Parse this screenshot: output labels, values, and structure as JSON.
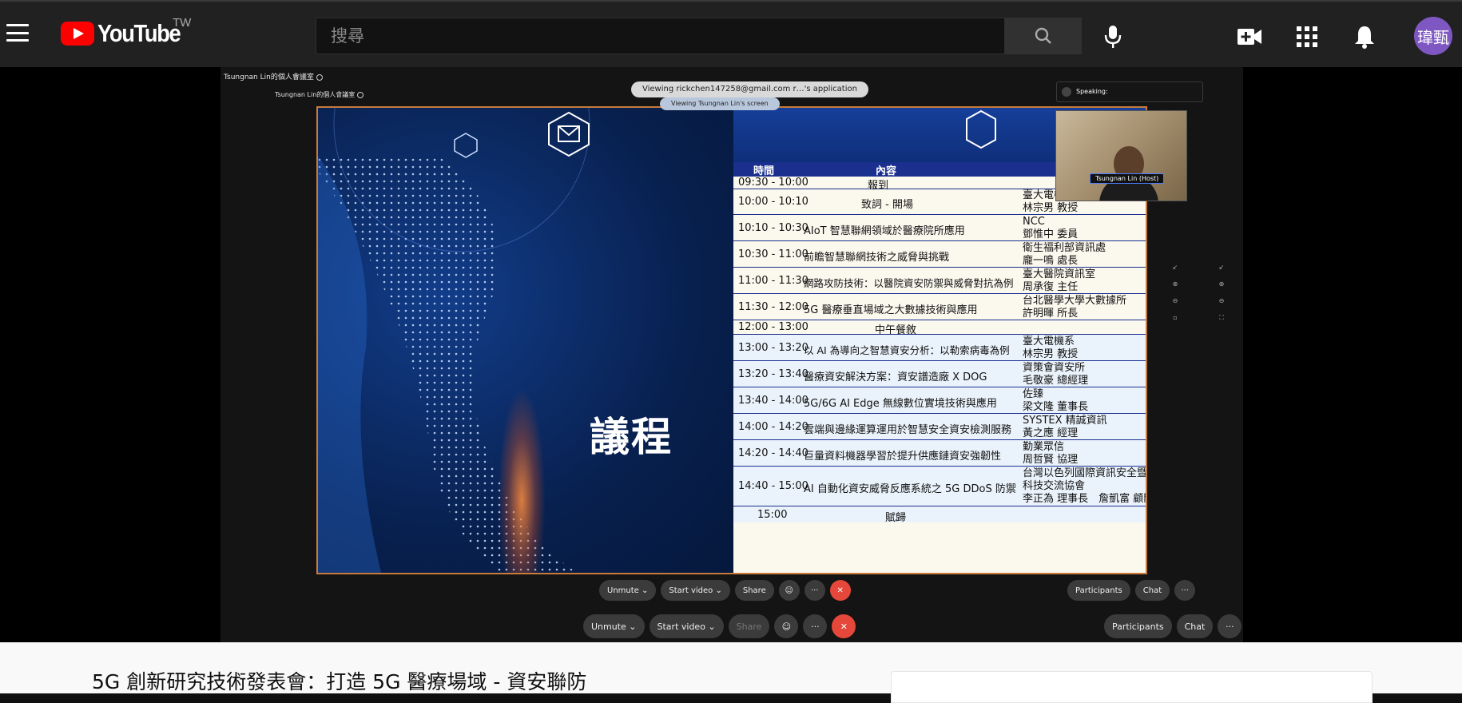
{
  "header": {
    "logo_text": "YouTube",
    "region": "TW",
    "search_placeholder": "搜尋",
    "avatar_text": "瑋甄",
    "icons": [
      "menu-icon",
      "search-icon",
      "mic-icon",
      "create-video-icon",
      "apps-grid-icon",
      "notifications-icon"
    ]
  },
  "meeting": {
    "room_title_outer": "Tsungnan Lin的個人會議室",
    "room_title_inner": "Tsungnan Lin的個人會議室",
    "viewing_app": "Viewing rickchen147258@gmail.com r…'s application",
    "viewing_screen": "Viewing Tsungnan Lin's screen",
    "speaking": "Speaking:",
    "host_tag": "Tsungnan Lin (Host)",
    "controls_inner": {
      "unmute": "Unmute",
      "start_video": "Start video",
      "share": "Share",
      "participants": "Participants",
      "chat": "Chat",
      "more": "···"
    },
    "controls_outer": {
      "unmute": "Unmute",
      "start_video": "Start video",
      "share": "Share",
      "participants": "Participants",
      "chat": "Chat",
      "more": "···"
    }
  },
  "slide": {
    "title": "議程",
    "head_time": "時間",
    "head_content": "內容",
    "rows": [
      {
        "time": "09:30 - 10:00",
        "content": "報到",
        "speaker1": "",
        "speaker2": ""
      },
      {
        "time": "10:00 - 10:10",
        "content": "致詞 - 開場",
        "speaker1": "臺大電機系",
        "speaker2": "林宗男 教授"
      },
      {
        "time": "10:10 - 10:30",
        "content": "AIoT 智慧聯網領域於醫療院所應用",
        "speaker1": "NCC",
        "speaker2": "鄧惟中 委員"
      },
      {
        "time": "10:30 - 11:00",
        "content": "前瞻智慧聯網技術之威脅與挑戰",
        "speaker1": "衛生福利部資訊處",
        "speaker2": "龐一鳴 處長"
      },
      {
        "time": "11:00 - 11:30",
        "content": "網路攻防技術：以醫院資安防禦與威脅對抗為例",
        "speaker1": "臺大醫院資訊室",
        "speaker2": "周承復 主任"
      },
      {
        "time": "11:30 - 12:00",
        "content": "5G 醫療垂直場域之大數據技術與應用",
        "speaker1": "台北醫學大學大數據所",
        "speaker2": "許明暉 所長"
      },
      {
        "time": "12:00 - 13:00",
        "content": "中午餐敘",
        "speaker1": "",
        "speaker2": ""
      },
      {
        "time": "13:00 - 13:20",
        "content": "以 AI 為導向之智慧資安分析：以勒索病毒為例",
        "speaker1": "臺大電機系",
        "speaker2": "林宗男 教授"
      },
      {
        "time": "13:20 - 13:40",
        "content": "醫療資安解決方案：資安譜造廠 X DOG",
        "speaker1": "資策會資安所",
        "speaker2": "毛敬豪 總經理"
      },
      {
        "time": "13:40 - 14:00",
        "content": "5G/6G AI Edge 無線數位實境技術與應用",
        "speaker1": "佐臻",
        "speaker2": "梁文隆 董事長"
      },
      {
        "time": "14:00 - 14:20",
        "content": "雲端與邊緣運算運用於智慧安全資安檢測服務",
        "speaker1": "SYSTEX 精誠資訊",
        "speaker2": "黃之應 經理"
      },
      {
        "time": "14:20 - 14:40",
        "content": "巨量資料機器學習於提升供應鏈資安強韌性",
        "speaker1": "勤業眾信",
        "speaker2": "周哲賢 協理"
      },
      {
        "time": "14:40 - 15:00",
        "content": "AI 自動化資安威脅反應系統之 5G DDoS 防禦",
        "speaker1": "台灣以色列國際資訊安全暨",
        "speaker2": "科技交流協會",
        "speaker3": "李正為 理事長　詹凱富 顧問"
      },
      {
        "time": "15:00",
        "content": "賦歸",
        "speaker1": "",
        "speaker2": ""
      }
    ]
  },
  "video": {
    "title": "5G 創新研究技術發表會：打造 5G 醫療場域 - 資安聯防"
  }
}
